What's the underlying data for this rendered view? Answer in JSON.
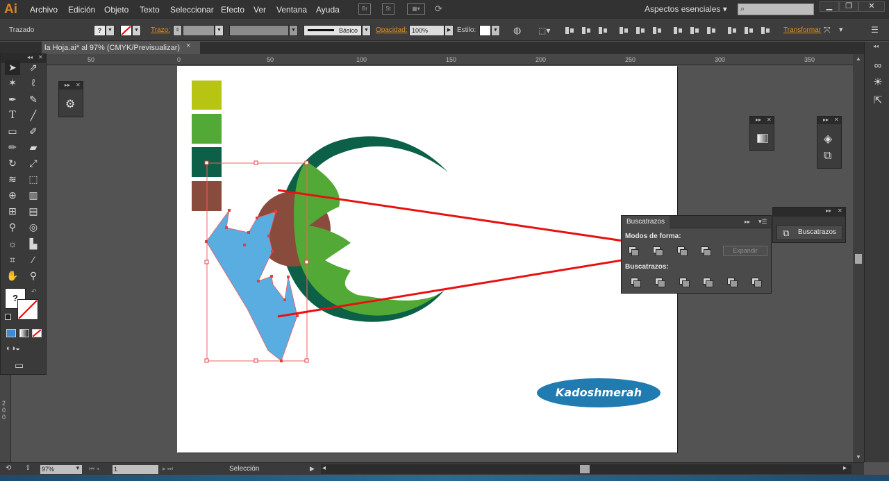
{
  "app": {
    "logo": "Ai"
  },
  "menubar": {
    "items": [
      "Archivo",
      "Edición",
      "Objeto",
      "Texto",
      "Seleccionar",
      "Efecto",
      "Ver",
      "Ventana",
      "Ayuda"
    ],
    "bridge_label": "Br",
    "stock_label": "St",
    "workspace": "Aspectos esenciales",
    "search_placeholder": ""
  },
  "control_bar": {
    "selection_type": "Trazado",
    "stroke_label": "Trazo:",
    "stroke_weight": "",
    "profile_value": "Básico",
    "opacity_label": "Opacidad:",
    "opacity_value": "100%",
    "style_label": "Estilo:",
    "transform_label": "Transformar"
  },
  "document": {
    "tab_title": "la Hoja.ai* al 97% (CMYK/Previsualizar)",
    "tab_close": "×"
  },
  "ruler": {
    "h_ticks": [
      "50",
      "0",
      "50",
      "100",
      "150",
      "200",
      "250",
      "300",
      "350"
    ],
    "v_ticks": [
      "2",
      "0",
      "0"
    ]
  },
  "pathfinder": {
    "tab_title": "Buscatrazos",
    "shape_modes_label": "Modos de forma:",
    "pathfinders_label": "Buscatrazos:",
    "expand_button": "Expandir",
    "collapsed_label": "Buscatrazos"
  },
  "artwork": {
    "swatches": [
      "#b7c412",
      "#53a936",
      "#0b6047",
      "#894c3c"
    ],
    "logo_text": "Kadoshmerah",
    "highlight_color": "#e81010"
  },
  "status": {
    "zoom": "97%",
    "page": "1",
    "tool": "Selección"
  },
  "icons": {
    "tools": [
      "selection-arrow",
      "direct-selection",
      "magic-wand",
      "lasso",
      "pen",
      "curvature",
      "type",
      "line",
      "rectangle",
      "paintbrush",
      "pencil",
      "eraser",
      "rotate",
      "scale",
      "warp",
      "free-transform",
      "shape-builder",
      "perspective",
      "mesh",
      "gradient",
      "eyedropper",
      "blend",
      "symbol-sprayer",
      "column-graph",
      "artboard",
      "slice",
      "hand",
      "zoom"
    ]
  }
}
